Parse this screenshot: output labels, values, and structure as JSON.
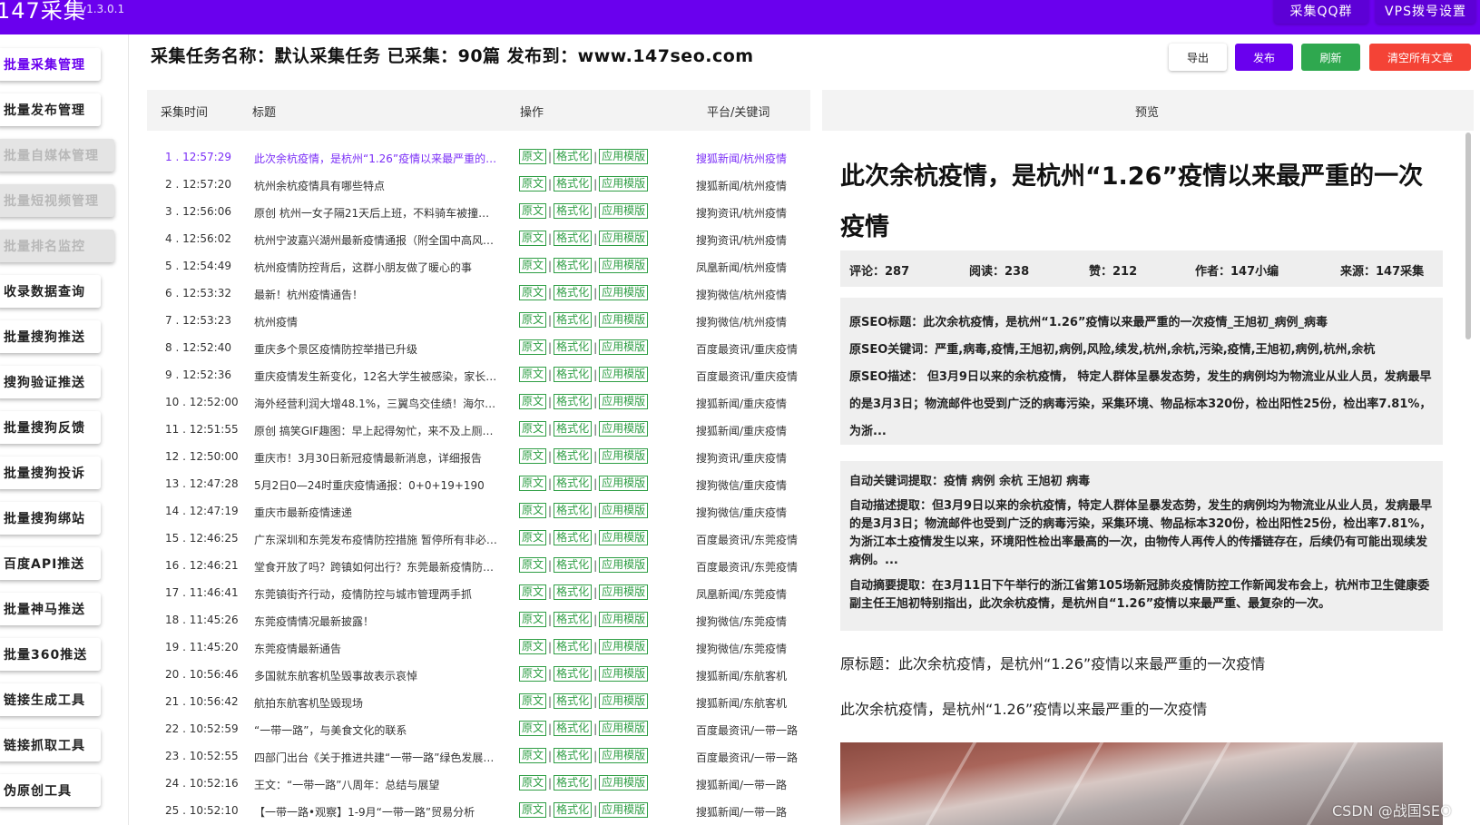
{
  "app": {
    "title": "147采集",
    "version": "v1.3.0.1"
  },
  "top_buttons": {
    "qq": "采集QQ群",
    "vps": "VPS拨号设置"
  },
  "sidebar": {
    "items": [
      {
        "label": "批量采集管理",
        "state": "active"
      },
      {
        "label": "批量发布管理",
        "state": "normal"
      },
      {
        "label": "批量自媒体管理",
        "state": "disabled"
      },
      {
        "label": "批量短视频管理",
        "state": "disabled"
      },
      {
        "label": "批量排名监控",
        "state": "disabled"
      },
      {
        "label": "收录数据查询",
        "state": "normal"
      },
      {
        "label": "批量搜狗推送",
        "state": "normal"
      },
      {
        "label": "搜狗验证推送",
        "state": "normal"
      },
      {
        "label": "批量搜狗反馈",
        "state": "normal"
      },
      {
        "label": "批量搜狗投诉",
        "state": "normal"
      },
      {
        "label": "批量搜狗绑站",
        "state": "normal"
      },
      {
        "label": "百度API推送",
        "state": "normal"
      },
      {
        "label": "批量神马推送",
        "state": "normal"
      },
      {
        "label": "批量360推送",
        "state": "normal"
      },
      {
        "label": "链接生成工具",
        "state": "normal"
      },
      {
        "label": "链接抓取工具",
        "state": "normal"
      },
      {
        "label": "伪原创工具",
        "state": "normal"
      }
    ]
  },
  "header": {
    "task_line": "采集任务名称：默认采集任务 已采集：90篇 发布到：www.147seo.com",
    "buttons": {
      "export": "导出",
      "publish": "发布",
      "refresh": "刷新",
      "clear": "清空所有文章"
    }
  },
  "table": {
    "columns": [
      "采集时间",
      "标题",
      "操作",
      "平台/关键词"
    ],
    "op_labels": [
      "原文",
      "格式化",
      "应用模版"
    ],
    "rows": [
      {
        "time": "1 . 12:57:29",
        "title": "此次余杭疫情，是杭州“1.26”疫情以来最严重的…",
        "platform": "搜狐新闻/杭州疫情",
        "highlight": true
      },
      {
        "time": "2 . 12:57:20",
        "title": "杭州余杭疫情具有哪些特点",
        "platform": "搜狐新闻/杭州疫情"
      },
      {
        "time": "3 . 12:56:06",
        "title": "原创 杭州一女子隔21天后上班，不料骑车被撞…",
        "platform": "搜狗资讯/杭州疫情"
      },
      {
        "time": "4 . 12:56:02",
        "title": "杭州宁波嘉兴湖州最新疫情通报（附全国中高风…",
        "platform": "搜狗资讯/杭州疫情"
      },
      {
        "time": "5 . 12:54:49",
        "title": "杭州疫情防控背后，这群小朋友做了暖心的事",
        "platform": "凤凰新闻/杭州疫情"
      },
      {
        "time": "6 . 12:53:32",
        "title": "最新！杭州疫情通告！",
        "platform": "搜狗微信/杭州疫情"
      },
      {
        "time": "7 . 12:53:23",
        "title": "杭州疫情",
        "platform": "搜狗微信/杭州疫情"
      },
      {
        "time": "8 . 12:52:40",
        "title": "重庆多个景区疫情防控举措已升级",
        "platform": "百度最资讯/重庆疫情"
      },
      {
        "time": "9 . 12:52:36",
        "title": "重庆疫情发生新变化，12名大学生被感染，家长…",
        "platform": "百度最资讯/重庆疫情"
      },
      {
        "time": "10 . 12:52:00",
        "title": "海外经营利润大增48.1%，三翼鸟交佳绩！海尔…",
        "platform": "搜狐新闻/重庆疫情"
      },
      {
        "time": "11 . 12:51:55",
        "title": "原创 搞笑GIF趣图：早上起得匆忙，来不及上厕…",
        "platform": "搜狐新闻/重庆疫情"
      },
      {
        "time": "12 . 12:50:00",
        "title": "重庆市！3月30日新冠疫情最新消息，详细报告",
        "platform": "搜狗资讯/重庆疫情"
      },
      {
        "time": "13 . 12:47:28",
        "title": "5月2日0—24时重庆疫情通报：0+0+19+190",
        "platform": "搜狗微信/重庆疫情"
      },
      {
        "time": "14 . 12:47:19",
        "title": "重庆市最新疫情速递",
        "platform": "搜狗微信/重庆疫情"
      },
      {
        "time": "15 . 12:46:25",
        "title": "广东深圳和东莞发布疫情防控措施 暂停所有非必…",
        "platform": "百度最资讯/东莞疫情"
      },
      {
        "time": "16 . 12:46:21",
        "title": "堂食开放了吗？跨镇如何出行？东莞最新疫情防…",
        "platform": "百度最资讯/东莞疫情"
      },
      {
        "time": "17 . 11:46:41",
        "title": "东莞镇街齐行动，疫情防控与城市管理两手抓",
        "platform": "凤凰新闻/东莞疫情"
      },
      {
        "time": "18 . 11:45:26",
        "title": "东莞疫情情况最新披露！",
        "platform": "搜狗微信/东莞疫情"
      },
      {
        "time": "19 . 11:45:20",
        "title": "东莞疫情最新通告",
        "platform": "搜狗微信/东莞疫情"
      },
      {
        "time": "20 . 10:56:46",
        "title": "多国就东航客机坠毁事故表示哀悼",
        "platform": "搜狐新闻/东航客机"
      },
      {
        "time": "21 . 10:56:42",
        "title": "航拍东航客机坠毁现场",
        "platform": "搜狐新闻/东航客机"
      },
      {
        "time": "22 . 10:52:59",
        "title": "“一带一路”，与美食文化的联系",
        "platform": "百度最资讯/一带一路"
      },
      {
        "time": "23 . 10:52:55",
        "title": "四部门出台《关于推进共建“一带一路”绿色发展…",
        "platform": "百度最资讯/一带一路"
      },
      {
        "time": "24 . 10:52:16",
        "title": "王文：“一带一路”八周年：总结与展望",
        "platform": "搜狐新闻/一带一路"
      },
      {
        "time": "25 . 10:52:10",
        "title": "【一带一路•观察】1-9月“一带一路”贸易分析",
        "platform": "搜狐新闻/一带一路"
      }
    ]
  },
  "preview": {
    "header": "预览",
    "title": "此次余杭疫情，是杭州“1.26”疫情以来最严重的一次疫情",
    "stats": {
      "comments": "评论：287",
      "reads": "阅读：238",
      "likes": "赞：212",
      "author": "作者：147小编",
      "source": "来源：147采集"
    },
    "seo": {
      "title": "原SEO标题：此次余杭疫情，是杭州“1.26”疫情以来最严重的一次疫情_王旭初_病例_病毒",
      "keywords": "原SEO关键词：严重,病毒,疫情,王旭初,病例,风险,续发,杭州,余杭,污染,疫情,王旭初,病例,杭州,余杭",
      "description": "原SEO描述： 但3月9日以来的余杭疫情， 特定人群体呈暴发态势，发生的病例均为物流业从业人员，发病最早的是3月3日；物流邮件也受到广泛的病毒污染，采集环境、物品标本320份，检出阳性25份，检出率7.81%， 为浙..."
    },
    "auto": {
      "keywords": "自动关键词提取：疫情 病例 余杭 王旭初 病毒",
      "description": "自动描述提取：但3月9日以来的余杭疫情，特定人群体呈暴发态势，发生的病例均为物流业从业人员，发病最早的是3月3日；物流邮件也受到广泛的病毒污染，采集环境、物品标本320份，检出阳性25份，检出率7.81%，为浙江本土疫情发生以来，环境阳性检出率最高的一次，由物传人再传人的传播链存在，后续仍有可能出现续发病例。...",
      "summary": "自动摘要提取：在3月11日下午举行的浙江省第105场新冠肺炎疫情防控工作新闻发布会上，杭州市卫生健康委副主任王旭初特别指出，此次余杭疫情，是杭州自“1.26”疫情以来最严重、最复杂的一次。"
    },
    "original_title": "原标题：此次余杭疫情，是杭州“1.26”疫情以来最严重的一次疫情",
    "subtitle": "此次余杭疫情，是杭州“1.26”疫情以来最严重的一次疫情"
  },
  "watermark": "CSDN @战国SEO",
  "colors": {
    "brand": "#6a00ee",
    "tag_green": "#2e9e44",
    "refresh": "#2fa84f",
    "clear": "#f44336",
    "highlight": "#7b2ff7"
  }
}
